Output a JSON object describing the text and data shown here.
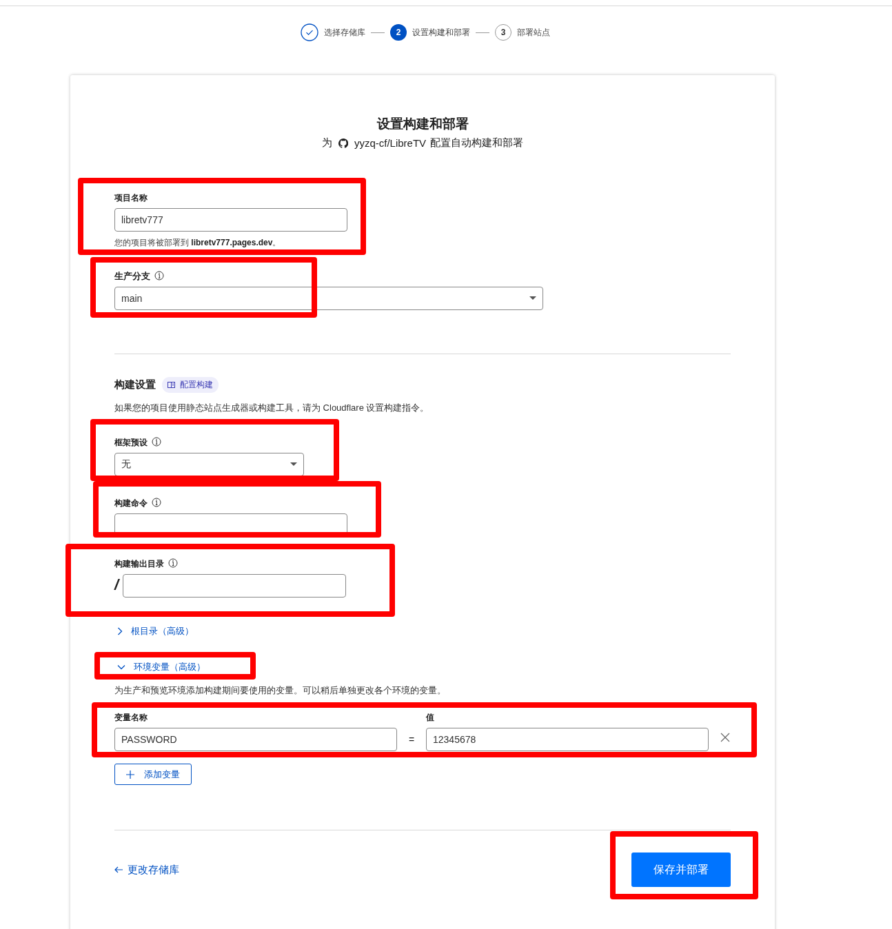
{
  "steps": [
    {
      "label": "选择存储库",
      "done": true,
      "selected": false
    },
    {
      "number": "2",
      "label": "设置构建和部署",
      "done": false,
      "selected": true
    },
    {
      "number": "3",
      "label": "部署站点",
      "done": false,
      "selected": false
    }
  ],
  "heading": {
    "title": "设置构建和部署",
    "subtitle_prefix": "为",
    "repo": "yyzq-cf/LibreTV",
    "subtitle_suffix": "配置自动构建和部署"
  },
  "project_name": {
    "label": "项目名称",
    "value": "libretv777",
    "hint": "您的项目将被部署到 **libretv777.pages.dev**。",
    "highlighted": true
  },
  "production_branch": {
    "label": "生产分支",
    "value": "main",
    "highlighted": true
  },
  "build_settings": {
    "title": "构建设置",
    "badge": "配置构建",
    "description": "如果您的项目使用静态站点生成器或构建工具，请为 Cloudflare 设置构建指令。",
    "fields": [
      {
        "kind": "select",
        "label": "框架预设",
        "value": "无",
        "highlighted": true
      },
      {
        "kind": "text",
        "label": "构建命令",
        "highlighted": true
      },
      {
        "kind": "prefixed",
        "label": "构建输出目录",
        "prefix": "/",
        "highlighted": true
      }
    ]
  },
  "root_directory": {
    "label": "根目录（高级）",
    "expanded": false
  },
  "environment_variables": {
    "label": "环境变量（高级）",
    "expanded": true,
    "highlighted": true,
    "description": "为生产和预览环境添加构建期间要使用的变量。可以稍后单独更改各个环境的变量。",
    "name_label": "变量名称",
    "value_label": "值",
    "separator": "=",
    "rows_highlighted": true,
    "variables": [
      {
        "name": "PASSWORD",
        "value": "12345678"
      }
    ],
    "add_button": "添加变量"
  },
  "footer": {
    "back_link": "更改存储库",
    "save_button": "保存并部署",
    "save_highlighted": true
  }
}
